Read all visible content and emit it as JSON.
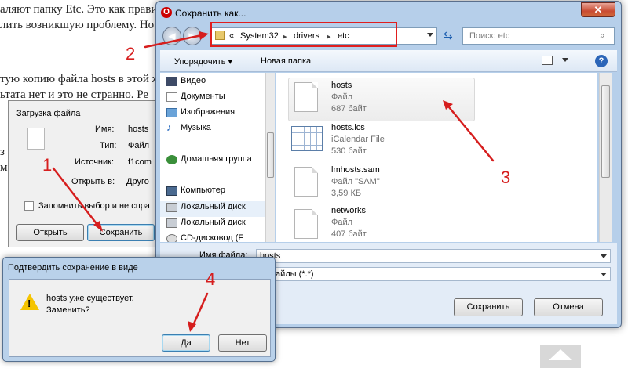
{
  "background": {
    "lines": [
      "аляют папку Etc. Это как прави",
      "лить возникшую проблему. Но",
      "тую копию файла hosts в этой ж",
      "ьтата нет и это не странно. Ре",
      "з",
      "м"
    ]
  },
  "download_dialog": {
    "title": "Загрузка файла",
    "name_label": "Имя:",
    "name_value": "hosts",
    "type_label": "Тип:",
    "type_value": "Файл",
    "source_label": "Источник:",
    "source_value": "f1com",
    "open_in_label": "Открыть в:",
    "open_in_value": "Друго",
    "remember_label": "Запомнить выбор и не спра",
    "open_button": "Открыть",
    "save_button": "Сохранить"
  },
  "save_as": {
    "title": "Сохранить как...",
    "close_symbol": "✕",
    "breadcrumb": {
      "overflow": "«",
      "items": [
        "System32",
        "drivers",
        "etc"
      ],
      "sep": "▸"
    },
    "search_placeholder": "Поиск: etc",
    "toolbar": {
      "organize": "Упорядочить ▾",
      "new_folder": "Новая папка"
    },
    "nav_items": [
      "Видео",
      "Документы",
      "Изображения",
      "Музыка",
      "Домашняя группа",
      "Компьютер",
      "Локальный диск",
      "Локальный диск",
      "CD-дисковод (F"
    ],
    "files": [
      {
        "name": "hosts",
        "type": "Файл",
        "size": "687 байт"
      },
      {
        "name": "hosts.ics",
        "type": "iCalendar File",
        "size": "530 байт"
      },
      {
        "name": "lmhosts.sam",
        "type": "Файл \"SAM\"",
        "size": "3,59 КБ"
      },
      {
        "name": "networks",
        "type": "Файл",
        "size": "407 байт"
      }
    ],
    "filename_label": "Имя файла:",
    "filename_value": "hosts",
    "filetype_value": "айлы (*.*)",
    "save_button": "Сохранить",
    "cancel_button": "Отмена"
  },
  "confirm_dialog": {
    "title": "Подтвердить сохранение в виде",
    "message_line1": "hosts уже существует.",
    "message_line2": "Заменить?",
    "yes_button": "Да",
    "no_button": "Нет"
  },
  "annotations": {
    "n1": "1",
    "n2": "2",
    "n3": "3",
    "n4": "4",
    "color": "#d61e1e"
  }
}
